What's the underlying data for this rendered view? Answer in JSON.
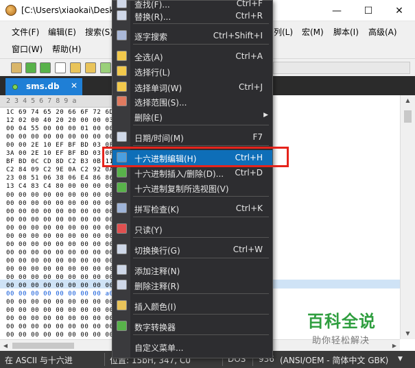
{
  "window": {
    "title": "[C:\\Users\\xiaokai\\Desk",
    "minimize": "—",
    "maximize": "☐",
    "close": "✕"
  },
  "menubar": {
    "row1": [
      "文件(F)",
      "编辑(E)",
      "搜索(S)",
      "列(L)",
      "宏(M)",
      "脚本(I)",
      "高级(A)"
    ],
    "row2": [
      "窗口(W)",
      "帮助(H)"
    ]
  },
  "tab": {
    "label": "sms.db",
    "close": "✕"
  },
  "editor": {
    "ruler": "2 3 4 5 6 7 8 9 a",
    "rows": [
      "1C 69 74 65 20 66 6F 72 6D",
      "12 02 00 40 20 20 00 00 03",
      "00 04 55 00 00 00 01 00 00",
      "00 00 00 00 00 00 00 00 00",
      "00 00 2E 10 EF BF BD 03 0F",
      "3A 00 2E 10 EF BF BD 03 0F",
      "BF BD 0C CD 8D C2 B3 0B 11",
      "C2 84 09 C2 9E 0A C2 92 0A",
      "23 08 51 06 38 06 E4 86 86",
      "13 C4 83 C4 80 00 00 00 00",
      "00 00 00 00 00 00 00 00 00",
      "00 00 00 00 00 00 00 00 00",
      "00 00 00 00 00 00 00 00 00",
      "00 00 00 00 00 00 00 00 00",
      "00 00 00 00 00 00 00 00 00",
      "00 00 00 00 00 00 00 00 00",
      "00 00 00 00 00 00 00 00 00",
      "00 00 00 00 00 00 00 00 00",
      "00 00 00 00 00 00 00 00 00",
      "00 00 00 00 00 00 00 00 00",
      "00 00 00 00 00 00 00 00 00",
      "00 00 00 00 00 00 00 00 00",
      "00 00 00 00 00 00 00 00 a0",
      "00 00 00 00 00 00 00 00 00",
      "00 00 00 00 00 00 00 00 00",
      "00 00 00 00 00 00 00 00 00",
      "00 00 00 00 00 00 00 00 00",
      "00 00 00 00 00 00 00 00 00"
    ]
  },
  "context_menu": {
    "items": [
      {
        "label": "查找(F)...",
        "shortcut": "Ctrl+F",
        "icon": "find-icon"
      },
      {
        "label": "替换(R)...",
        "shortcut": "Ctrl+R",
        "icon": "replace-icon"
      },
      {
        "label": "逐字搜索",
        "shortcut": "Ctrl+Shift+I",
        "icon": "incremental-search-icon"
      },
      {
        "label": "全选(A)",
        "shortcut": "Ctrl+A",
        "icon": "select-all-icon"
      },
      {
        "label": "选择行(L)",
        "shortcut": "",
        "icon": "select-line-icon"
      },
      {
        "label": "选择单词(W)",
        "shortcut": "Ctrl+J",
        "icon": "select-word-icon"
      },
      {
        "label": "选择范围(S)...",
        "shortcut": "",
        "icon": "select-range-icon"
      },
      {
        "label": "删除(E)",
        "shortcut": "",
        "icon": "",
        "submenu": true
      },
      {
        "label": "日期/时间(M)",
        "shortcut": "F7",
        "icon": "date-time-icon"
      },
      {
        "label": "十六进制编辑(H)",
        "shortcut": "Ctrl+H",
        "icon": "hex-edit-icon",
        "active": true
      },
      {
        "label": "十六进制插入/删除(D)...",
        "shortcut": "Ctrl+D",
        "icon": "hex-insert-delete-icon"
      },
      {
        "label": "十六进制复制所选视图(V)",
        "shortcut": "",
        "icon": "hex-copy-icon"
      },
      {
        "label": "拼写检查(K)",
        "shortcut": "Ctrl+K",
        "icon": "spell-check-icon"
      },
      {
        "label": "只读(Y)",
        "shortcut": "",
        "icon": "read-only-icon"
      },
      {
        "label": "切换换行(G)",
        "shortcut": "Ctrl+W",
        "icon": "word-wrap-icon"
      },
      {
        "label": "添加注释(N)",
        "shortcut": "",
        "icon": "add-comment-icon"
      },
      {
        "label": "删除注释(R)",
        "shortcut": "",
        "icon": "remove-comment-icon"
      },
      {
        "label": "插入颜色(I)",
        "shortcut": "",
        "icon": "insert-color-icon"
      },
      {
        "label": "数字转换器",
        "shortcut": "",
        "icon": "number-converter-icon"
      },
      {
        "label": "自定义菜单...",
        "shortcut": "",
        "icon": ""
      }
    ]
  },
  "statusbar": {
    "mode": "在 ASCII 与十六进",
    "position": "位置: 15bH, 347, C0",
    "line_ending": "DOS",
    "encoding_code": "936",
    "encoding": "(ANSI/OEM - 简体中文 GBK)"
  },
  "watermark": {
    "logo": "百科全说",
    "subtitle": "助你轻松解决"
  },
  "colors": {
    "highlight_menu": "#0e6eb8",
    "red_annotation": "#e5231b",
    "tab_active": "#1f7fd6",
    "menu_bg": "#2d2d30"
  }
}
